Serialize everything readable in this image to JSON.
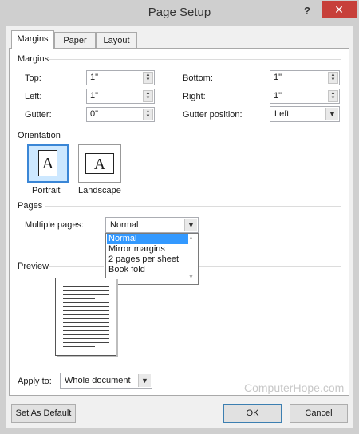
{
  "window": {
    "title": "Page Setup",
    "help_glyph": "?",
    "close_glyph": "✕"
  },
  "tabs": [
    {
      "label": "Margins",
      "selected": true
    },
    {
      "label": "Paper",
      "selected": false
    },
    {
      "label": "Layout",
      "selected": false
    }
  ],
  "margins": {
    "group_label": "Margins",
    "top": {
      "label": "Top:",
      "value": "1\""
    },
    "bottom": {
      "label": "Bottom:",
      "value": "1\""
    },
    "left": {
      "label": "Left:",
      "value": "1\""
    },
    "right": {
      "label": "Right:",
      "value": "1\""
    },
    "gutter": {
      "label": "Gutter:",
      "value": "0\""
    },
    "gutter_position": {
      "label": "Gutter position:",
      "value": "Left"
    }
  },
  "orientation": {
    "group_label": "Orientation",
    "portrait_label": "Portrait",
    "landscape_label": "Landscape",
    "icon_letter": "A",
    "selected": "portrait"
  },
  "pages": {
    "group_label": "Pages",
    "multiple_label": "Multiple pages:",
    "selected": "Normal",
    "options": [
      "Normal",
      "Mirror margins",
      "2 pages per sheet",
      "Book fold"
    ]
  },
  "preview": {
    "group_label": "Preview"
  },
  "apply_to": {
    "label": "Apply to:",
    "value": "Whole document"
  },
  "buttons": {
    "set_default": "Set As Default",
    "ok": "OK",
    "cancel": "Cancel"
  },
  "watermark": "ComputerHope.com",
  "colors": {
    "selection": "#3399ff",
    "close": "#c7403a",
    "accent": "#3a86d6"
  }
}
